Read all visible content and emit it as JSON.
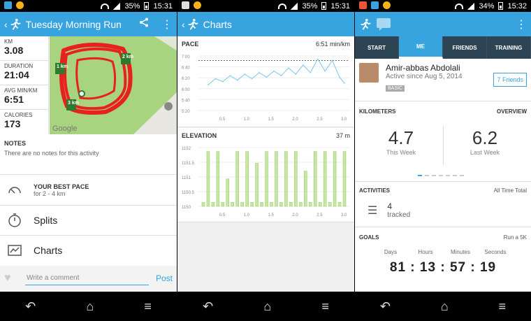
{
  "status1": {
    "battery": "35%",
    "time": "15:31"
  },
  "status2": {
    "battery": "35%",
    "time": "15:31"
  },
  "status3": {
    "battery": "34%",
    "time": "15:32"
  },
  "activity": {
    "title": "Tuesday Morning Run",
    "stats": [
      {
        "label": "KM",
        "value": "3.08"
      },
      {
        "label": "DURATION",
        "value": "21:04"
      },
      {
        "label": "AVG MIN/KM",
        "value": "6:51"
      },
      {
        "label": "CALORIES",
        "value": "173"
      }
    ],
    "map_markers": [
      "1 km",
      "2 km",
      "3 km"
    ],
    "map_logo": "Google",
    "notes_heading": "NOTES",
    "notes_text": "There are no notes for this activity",
    "best_pace_title": "YOUR BEST PACE",
    "best_pace_sub": "for 2 - 4 km",
    "splits": "Splits",
    "charts": "Charts",
    "comment_placeholder": "Write a comment",
    "post": "Post"
  },
  "charts_screen": {
    "title": "Charts",
    "pace_label": "PACE",
    "pace_value": "6:51 min/km",
    "elevation_label": "ELEVATION",
    "elevation_value": "37 m"
  },
  "chart_data": [
    {
      "type": "line",
      "title": "PACE",
      "x": [
        0.2,
        0.35,
        0.5,
        0.65,
        0.8,
        0.95,
        1.1,
        1.25,
        1.4,
        1.55,
        1.7,
        1.85,
        2.0,
        2.15,
        2.3,
        2.45,
        2.6,
        2.75,
        2.9,
        3.0
      ],
      "series": [
        {
          "values": [
            6.05,
            6.25,
            6.15,
            6.35,
            6.2,
            6.4,
            6.25,
            6.45,
            6.3,
            6.5,
            6.35,
            6.6,
            6.4,
            6.7,
            6.45,
            6.9,
            6.5,
            6.85,
            6.3,
            6.1
          ]
        }
      ],
      "ylim": [
        5.2,
        7.0
      ],
      "y_ticks": [
        "7:00",
        "6:40",
        "6:20",
        "6:00",
        "5:40",
        "5:20"
      ],
      "x_ticks": [
        "0.5",
        "1.0",
        "1.5",
        "2.0",
        "2.5",
        "3.0"
      ],
      "reference_line": 6.85
    },
    {
      "type": "area",
      "title": "ELEVATION",
      "x": [
        0.1,
        0.2,
        0.3,
        0.4,
        0.5,
        0.6,
        0.7,
        0.8,
        0.9,
        1.0,
        1.1,
        1.2,
        1.3,
        1.4,
        1.5,
        1.6,
        1.7,
        1.8,
        1.9,
        2.0,
        2.1,
        2.2,
        2.3,
        2.4,
        2.5,
        2.6,
        2.7,
        2.8,
        2.9,
        3.0
      ],
      "series": [
        {
          "values": [
            1150.6,
            1151.9,
            1150.6,
            1151.9,
            1150.6,
            1151.2,
            1150.6,
            1151.9,
            1150.6,
            1151.9,
            1150.6,
            1151.6,
            1150.6,
            1151.9,
            1150.6,
            1151.9,
            1150.6,
            1151.9,
            1150.6,
            1151.9,
            1150.6,
            1151.4,
            1150.6,
            1151.9,
            1150.6,
            1151.9,
            1150.6,
            1151.9,
            1150.6,
            1151.9
          ]
        }
      ],
      "ylim": [
        1150.5,
        1152
      ],
      "y_ticks": [
        "1152",
        "1151.5",
        "1151",
        "1150.5",
        "1150"
      ],
      "x_ticks": [
        "0.5",
        "1.0",
        "1.5",
        "2.0",
        "2.5",
        "3.0"
      ]
    }
  ],
  "me": {
    "tabs": [
      "START",
      "ME",
      "FRIENDS",
      "TRAINING"
    ],
    "name": "Amir-abbas Abdolali",
    "since": "Active since Aug 5, 2014",
    "badge": "BASIC",
    "friends_btn": "7 Friends",
    "km_label": "KILOMETERS",
    "overview": "OVERVIEW",
    "this_week_value": "4.7",
    "this_week_label": "This Week",
    "last_week_value": "6.2",
    "last_week_label": "Last Week",
    "activities_label": "ACTIVITIES",
    "all_time": "All Time Total",
    "tracked_count": "4",
    "tracked_label": "tracked",
    "goals_label": "GOALS",
    "goal_name": "Run a 5K",
    "countdown_labels": [
      "Days",
      "Hours",
      "Minutes",
      "Seconds"
    ],
    "countdown_values": [
      "81",
      "13",
      "57",
      "19"
    ]
  }
}
